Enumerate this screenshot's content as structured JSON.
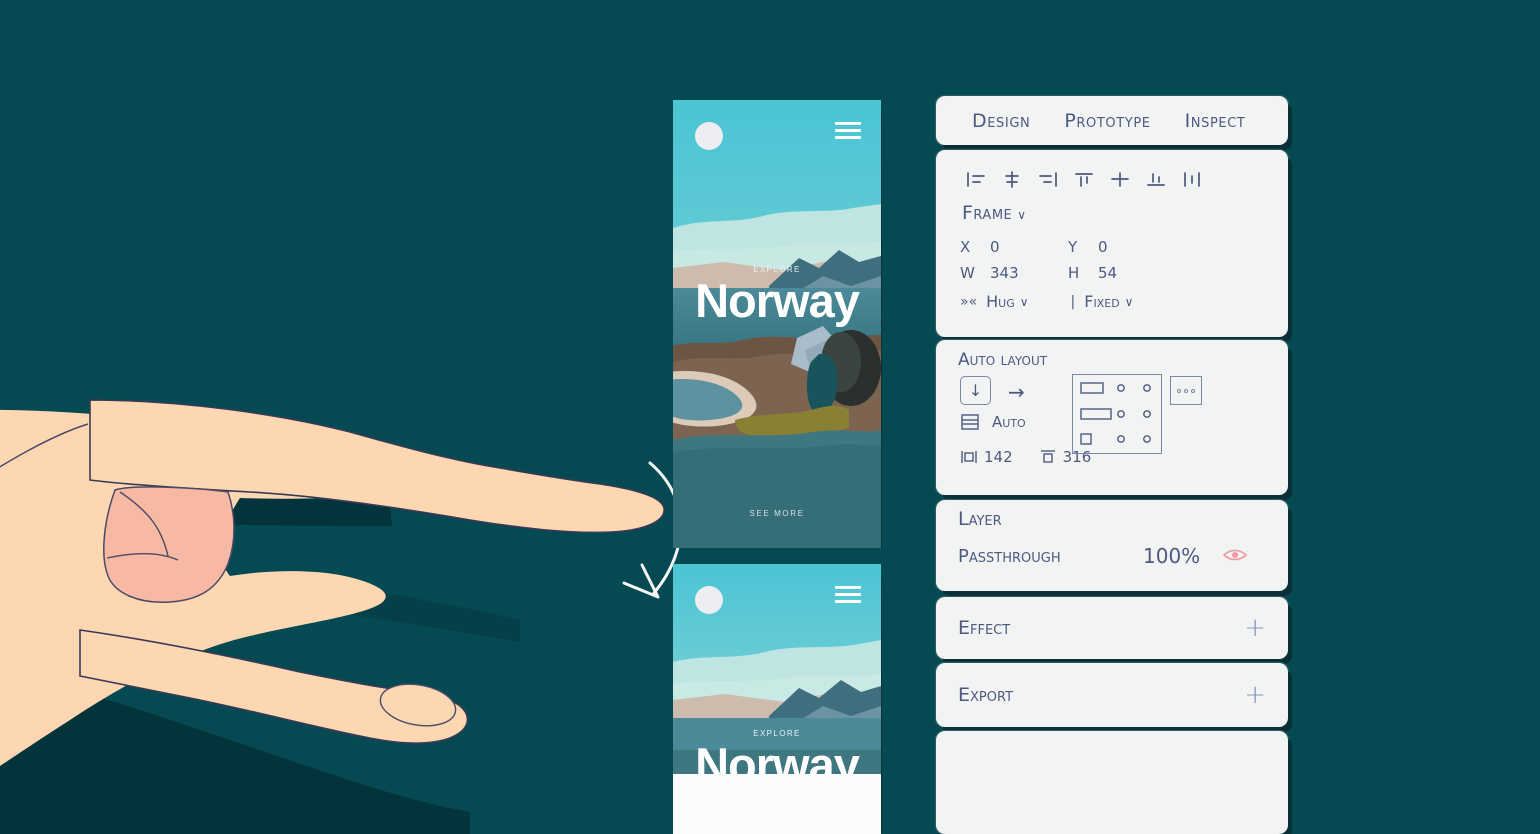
{
  "theme": {
    "background": "#054a52",
    "panel_bg": "#f2f3f3",
    "ink": "#4d5a80",
    "accent_pink": "#ef9a9f",
    "plus_blue": "#8694bb"
  },
  "tabs": {
    "items": [
      {
        "label": "Design",
        "active": true
      },
      {
        "label": "Prototype",
        "active": false
      },
      {
        "label": "Inspect",
        "active": false
      }
    ]
  },
  "frame_panel": {
    "align_icons": [
      "align-left-icon",
      "align-horizontal-center-icon",
      "align-right-icon",
      "align-top-icon",
      "align-vertical-center-icon",
      "align-bottom-icon",
      "distribute-icon"
    ],
    "frame_dropdown_label": "Frame",
    "chevron": "∨",
    "fields": [
      {
        "key": "X",
        "value": "0"
      },
      {
        "key": "Y",
        "value": "0"
      },
      {
        "key": "W",
        "value": "343"
      },
      {
        "key": "H",
        "value": "54"
      }
    ],
    "resize": {
      "horizontal_icon": "»«",
      "horizontal_label": "Hug",
      "vertical_icon": "|",
      "vertical_label": "Fixed",
      "chevron": "∨"
    }
  },
  "auto_layout": {
    "title": "Auto layout",
    "direction_icon": "↓",
    "direction_alt_icon": "→",
    "spacing_icon": "spacing-icon",
    "spacing_value": "Auto",
    "padding_horizontal": "142",
    "padding_vertical": "316",
    "padding_h_icon": "horizontal-padding-icon",
    "padding_v_icon": "vertical-padding-icon",
    "alignment_grid_icon": "alignment-grid-icon",
    "more_options_icon": "more-options-icon"
  },
  "layer": {
    "title": "Layer",
    "blend_mode": "Passthrough",
    "opacity": "100%",
    "visibility_icon": "eye-icon"
  },
  "effect": {
    "title": "Effect",
    "add_label": "+"
  },
  "export": {
    "title": "Export",
    "add_label": "+"
  },
  "mockup_top": {
    "eyebrow": "EXPLORE",
    "title": "Norway",
    "cta": "SEE MORE",
    "menu_icon": "hamburger-menu-icon",
    "sun_icon": "sun-icon"
  },
  "mockup_bottom": {
    "eyebrow": "EXPLORE",
    "title": "Norway",
    "menu_icon": "hamburger-menu-icon",
    "sun_icon": "sun-icon"
  },
  "annotation": {
    "arrow_icon": "curved-down-arrow-icon",
    "hand_icon": "pinch-gesture-hand-icon"
  }
}
